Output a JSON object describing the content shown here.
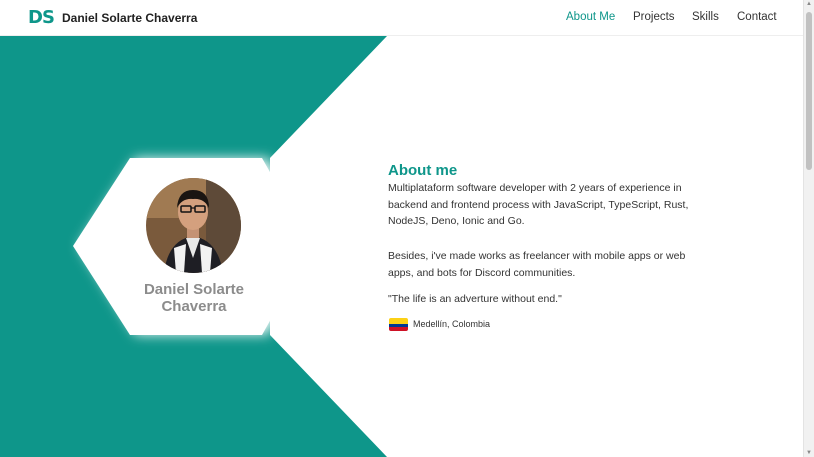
{
  "header": {
    "logo": "DS",
    "name": "Daniel Solarte Chaverra",
    "nav": [
      "About Me",
      "Projects",
      "Skills",
      "Contact"
    ],
    "active_nav": "About Me"
  },
  "profile": {
    "name_line1": "Daniel Solarte",
    "name_line2": "Chaverra"
  },
  "about": {
    "title": "About me",
    "paragraph1": "Multiplataform software developer with 2 years of experience in backend and frontend process with JavaScript, TypeScript, Rust, NodeJS, Deno, Ionic and Go.",
    "paragraph2": "Besides, i've made works as freelancer with mobile apps or web apps, and bots for Discord communities.",
    "quote": "\"The life is an adverture without end.\"",
    "location": "Medellín, Colombia",
    "flag_icon": "colombia-flag-icon"
  },
  "colors": {
    "accent": "#0e968a",
    "text": "#333333",
    "muted": "#8c8c8c"
  }
}
